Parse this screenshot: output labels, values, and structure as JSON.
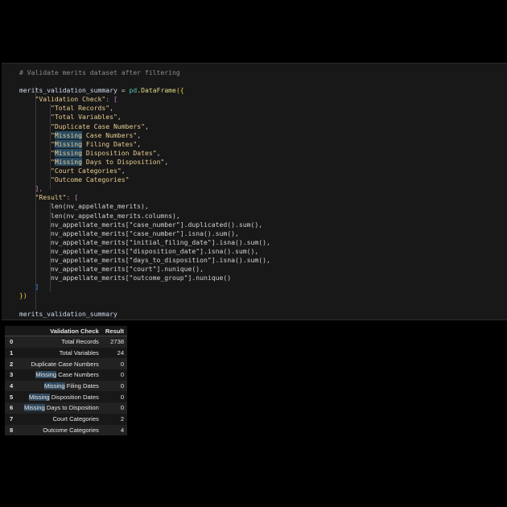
{
  "cell": {
    "comment": "# Validate merits dataset after filtering",
    "assign_name": "merits_validation_summary",
    "assign_op": " = ",
    "module": "pd",
    "func": ".DataFrame",
    "open": "({",
    "key1": "\"Validation Check\"",
    "key2": "\"Result\"",
    "colon_bracket": ": [",
    "checks": [
      "Total Records",
      "Total Variables",
      "Duplicate Case Numbers",
      "Missing Case Numbers",
      "Missing Filing Dates",
      "Missing Disposition Dates",
      "Missing Days to Disposition",
      "Court Categories",
      "Outcome Categories"
    ],
    "result_lines": [
      "len(nv_appellate_merits),",
      "len(nv_appellate_merits.columns),",
      "nv_appellate_merits[\"case_number\"].duplicated().sum(),",
      "nv_appellate_merits[\"case_number\"].isna().sum(),",
      "nv_appellate_merits[\"initial_filing_date\"].isna().sum(),",
      "nv_appellate_merits[\"disposition_date\"].isna().sum(),",
      "nv_appellate_merits[\"days_to_disposition\"].isna().sum(),",
      "nv_appellate_merits[\"court\"].nunique(),",
      "nv_appellate_merits[\"outcome_group\"].nunique()"
    ],
    "close_list_comma": "],",
    "close_list": "]",
    "close_all": "})",
    "display_name": "merits_validation_summary"
  },
  "output": {
    "columns": [
      "Validation Check",
      "Result"
    ],
    "rows": [
      {
        "index": "0",
        "check": "Total Records",
        "result": "2738"
      },
      {
        "index": "1",
        "check": "Total Variables",
        "result": "24"
      },
      {
        "index": "2",
        "check": "Duplicate Case Numbers",
        "result": "0"
      },
      {
        "index": "3",
        "check_hl": "Missing",
        "check_rest": " Case Numbers",
        "result": "0"
      },
      {
        "index": "4",
        "check_hl": "Missing",
        "check_rest": " Filing Dates",
        "result": "0"
      },
      {
        "index": "5",
        "check_hl": "Missing",
        "check_rest": " Disposition Dates",
        "result": "0"
      },
      {
        "index": "6",
        "check_hl": "Missing",
        "check_rest": " Days to Disposition",
        "result": "0"
      },
      {
        "index": "7",
        "check": "Court Categories",
        "result": "2"
      },
      {
        "index": "8",
        "check": "Outcome Categories",
        "result": "4"
      }
    ]
  },
  "colors": {
    "page_bg": "#000000",
    "cell_bg": "#181818",
    "string": "#e8cc8f",
    "comment": "#8b8b8b",
    "find_highlight": "#264a63"
  }
}
